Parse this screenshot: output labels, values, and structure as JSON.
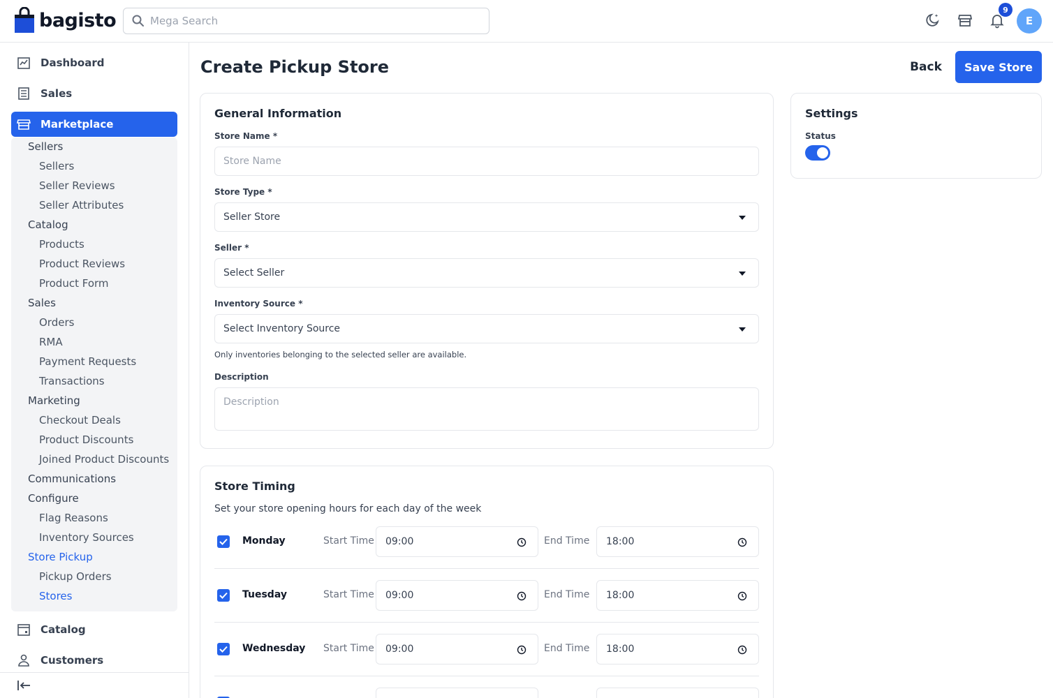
{
  "brand": {
    "name": "bagisto"
  },
  "search": {
    "placeholder": "Mega Search"
  },
  "header": {
    "notification_count": "9",
    "avatar_initial": "E"
  },
  "sidebar": {
    "top_items": [
      {
        "label": "Dashboard",
        "icon": "dashboard-icon"
      },
      {
        "label": "Sales",
        "icon": "sales-icon"
      },
      {
        "label": "Marketplace",
        "icon": "store-icon",
        "active": true
      }
    ],
    "marketplace_sub": [
      {
        "label": "Sellers",
        "level": 1
      },
      {
        "label": "Sellers",
        "level": 2
      },
      {
        "label": "Seller Reviews",
        "level": 2
      },
      {
        "label": "Seller Attributes",
        "level": 2
      },
      {
        "label": "Catalog",
        "level": 1
      },
      {
        "label": "Products",
        "level": 2
      },
      {
        "label": "Product Reviews",
        "level": 2
      },
      {
        "label": "Product Form",
        "level": 2
      },
      {
        "label": "Sales",
        "level": 1
      },
      {
        "label": "Orders",
        "level": 2
      },
      {
        "label": "RMA",
        "level": 2
      },
      {
        "label": "Payment Requests",
        "level": 2
      },
      {
        "label": "Transactions",
        "level": 2
      },
      {
        "label": "Marketing",
        "level": 1
      },
      {
        "label": "Checkout Deals",
        "level": 2
      },
      {
        "label": "Product Discounts",
        "level": 2
      },
      {
        "label": "Joined Product Discounts",
        "level": 2
      },
      {
        "label": "Communications",
        "level": 1
      },
      {
        "label": "Configure",
        "level": 1
      },
      {
        "label": "Flag Reasons",
        "level": 2
      },
      {
        "label": "Inventory Sources",
        "level": 2
      },
      {
        "label": "Store Pickup",
        "level": 1,
        "active": true
      },
      {
        "label": "Pickup Orders",
        "level": 2
      },
      {
        "label": "Stores",
        "level": 2,
        "active": true
      }
    ],
    "bottom_items": [
      {
        "label": "Catalog",
        "icon": "catalog-icon"
      },
      {
        "label": "Customers",
        "icon": "customers-icon"
      }
    ]
  },
  "page": {
    "title": "Create Pickup Store",
    "back_label": "Back",
    "save_label": "Save Store"
  },
  "general": {
    "title": "General Information",
    "store_name_label": "Store Name *",
    "store_name_placeholder": "Store Name",
    "store_type_label": "Store Type *",
    "store_type_value": "Seller Store",
    "seller_label": "Seller *",
    "seller_value": "Select Seller",
    "inventory_label": "Inventory Source *",
    "inventory_value": "Select Inventory Source",
    "inventory_hint": "Only inventories belonging to the selected seller are available.",
    "description_label": "Description",
    "description_placeholder": "Description"
  },
  "settings": {
    "title": "Settings",
    "status_label": "Status",
    "status_on": true
  },
  "timing": {
    "title": "Store Timing",
    "subtitle": "Set your store opening hours for each day of the week",
    "start_label": "Start Time",
    "end_label": "End Time",
    "days": [
      {
        "day": "Monday",
        "checked": true,
        "start": "09:00",
        "end": "18:00"
      },
      {
        "day": "Tuesday",
        "checked": true,
        "start": "09:00",
        "end": "18:00"
      },
      {
        "day": "Wednesday",
        "checked": true,
        "start": "09:00",
        "end": "18:00"
      }
    ]
  },
  "colors": {
    "primary": "#2563eb",
    "avatar": "#60a5fa",
    "submenu_bg": "#f3f4f6"
  }
}
